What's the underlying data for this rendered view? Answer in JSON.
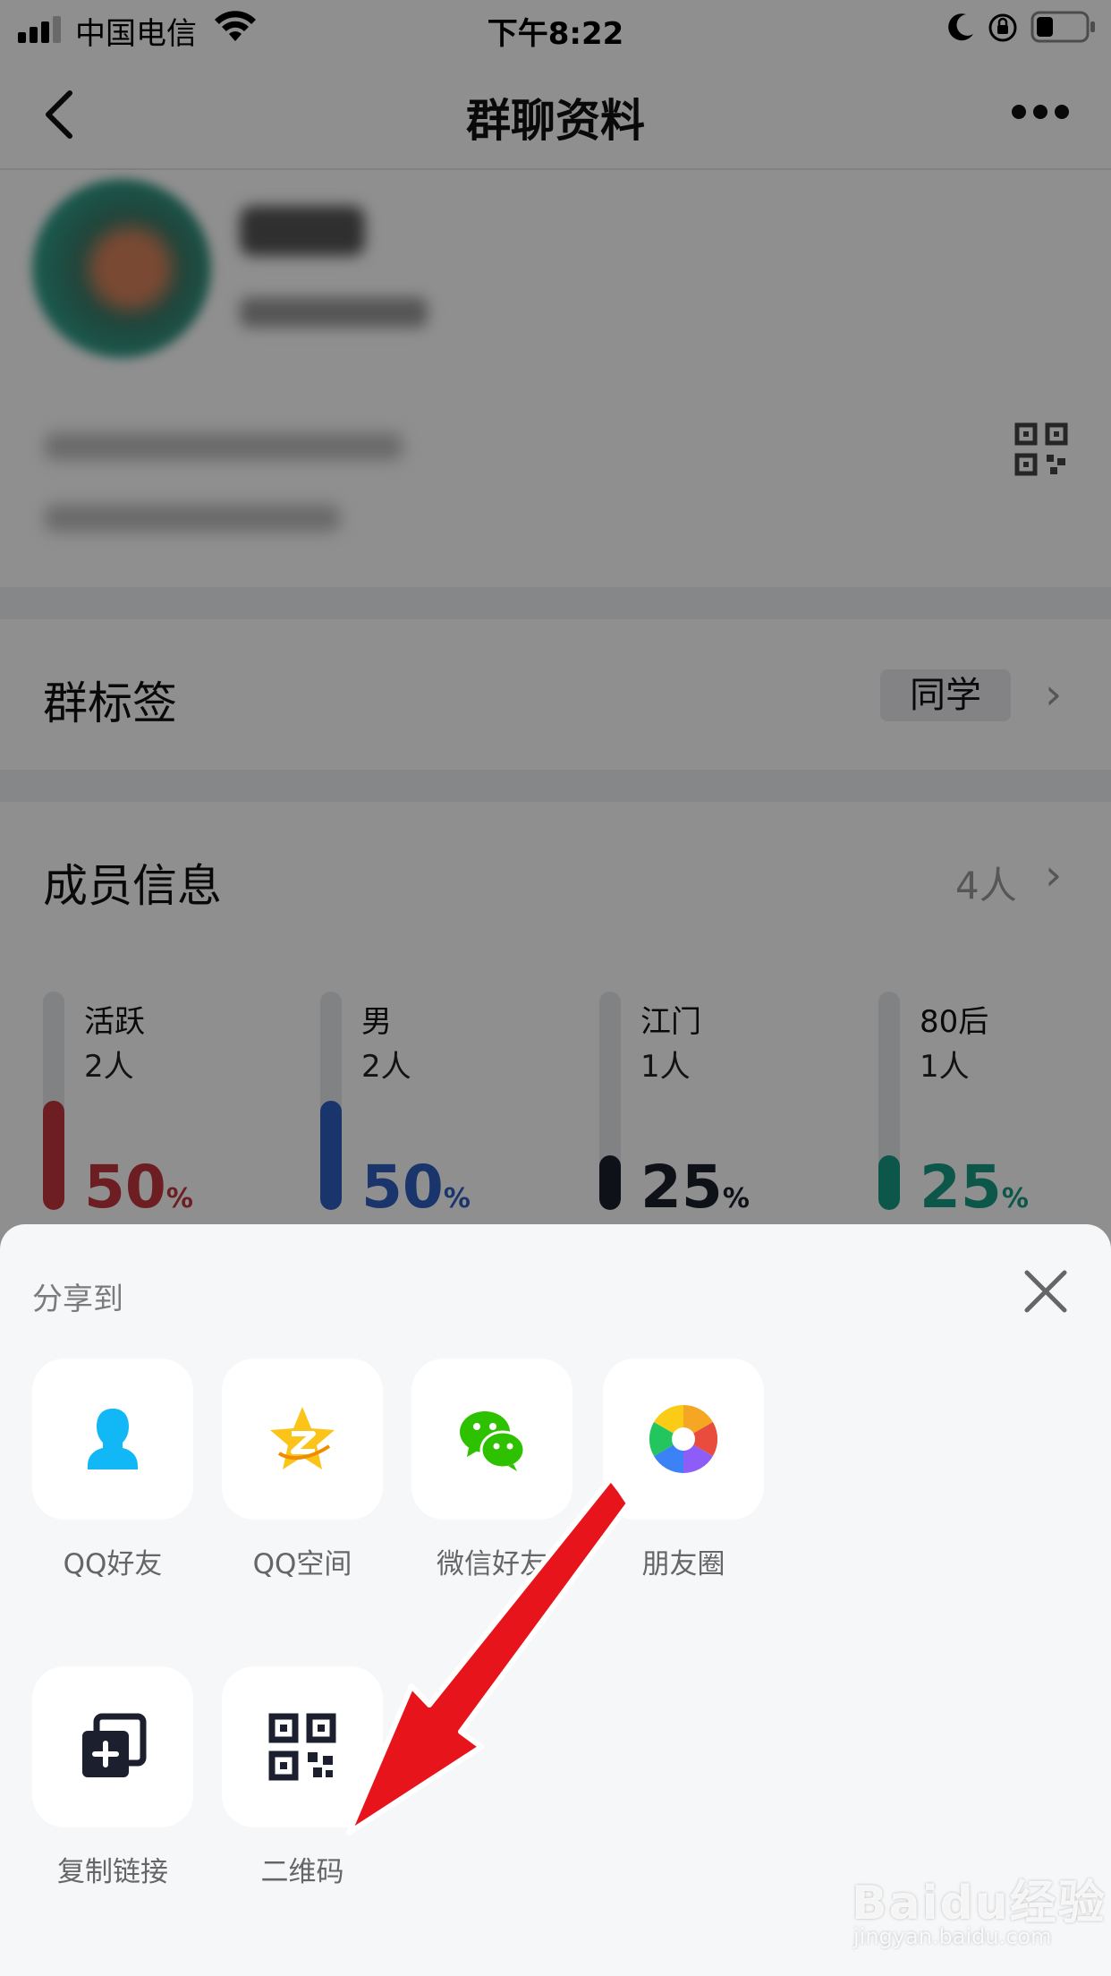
{
  "status_bar": {
    "carrier": "中国电信",
    "time": "下午8:22"
  },
  "nav": {
    "title": "群聊资料",
    "back_icon": "chevron-left-icon",
    "more_icon": "more-dots-icon"
  },
  "group_tag": {
    "label": "群标签",
    "value": "同学"
  },
  "members": {
    "label": "成员信息",
    "count": "4人"
  },
  "stats": [
    {
      "label": "活跃",
      "count": "2人",
      "percent": "50",
      "unit": "%",
      "color": "#c2363f",
      "fill": 0.5
    },
    {
      "label": "男",
      "count": "2人",
      "percent": "50",
      "unit": "%",
      "color": "#2f5fbf",
      "fill": 0.5
    },
    {
      "label": "江门",
      "count": "1人",
      "percent": "25",
      "unit": "%",
      "color": "#1c1f2e",
      "fill": 0.25
    },
    {
      "label": "80后",
      "count": "1人",
      "percent": "25",
      "unit": "%",
      "color": "#169a84",
      "fill": 0.25
    }
  ],
  "share": {
    "title": "分享到",
    "items": [
      {
        "label": "QQ好友",
        "icon": "qq-friend-icon"
      },
      {
        "label": "QQ空间",
        "icon": "qzone-star-icon"
      },
      {
        "label": "微信好友",
        "icon": "wechat-icon"
      },
      {
        "label": "朋友圈",
        "icon": "moments-aperture-icon"
      },
      {
        "label": "复制链接",
        "icon": "copy-link-icon"
      },
      {
        "label": "二维码",
        "icon": "qr-code-icon"
      }
    ]
  },
  "watermark": {
    "brand": "Baidu经验",
    "url": "jingyan.baidu.com"
  }
}
